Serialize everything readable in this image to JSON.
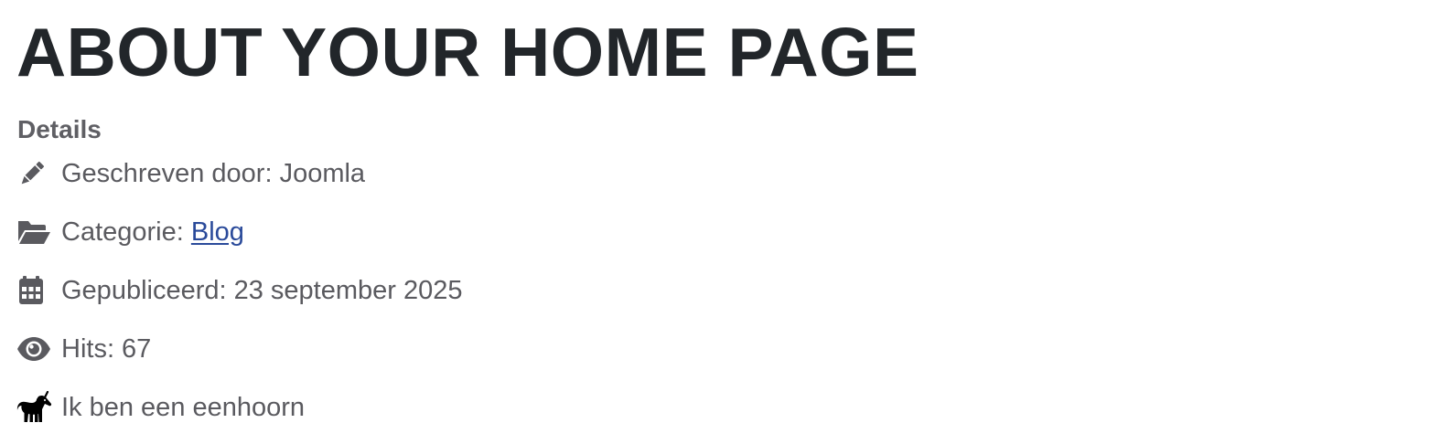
{
  "article": {
    "title": "ABOUT YOUR HOME PAGE"
  },
  "details": {
    "heading": "Details",
    "author": {
      "icon": "pencil-icon",
      "label": "Geschreven door: Joomla"
    },
    "category": {
      "icon": "folder-open-icon",
      "prefix": "Categorie:",
      "link_text": "Blog"
    },
    "published": {
      "icon": "calendar-icon",
      "label": "Gepubliceerd: 23 september 2025"
    },
    "hits": {
      "icon": "eye-icon",
      "label": "Hits: 67"
    },
    "custom": {
      "icon": "unicorn-icon",
      "label": "Ik ben een eenhoorn"
    }
  },
  "colors": {
    "title": "#22262a",
    "text": "#5a5a5f",
    "link": "#2a4a9a"
  }
}
